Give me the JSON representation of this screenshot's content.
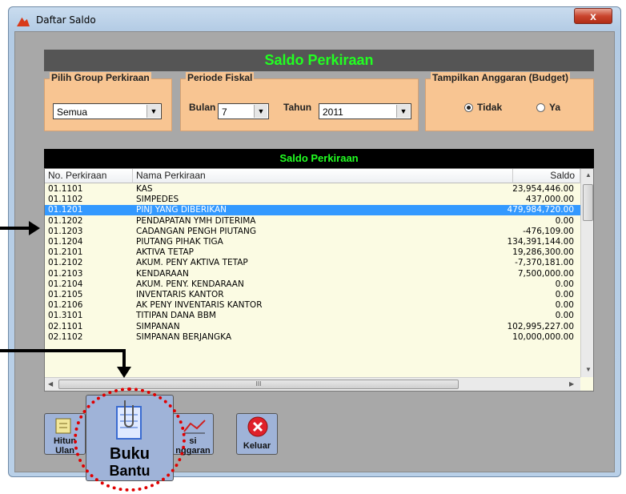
{
  "window": {
    "title": "Daftar Saldo",
    "close": "x"
  },
  "header": {
    "title": "Saldo Perkiraan"
  },
  "filters": {
    "group_label": "Pilih Group Perkiraan",
    "group_value": "Semua",
    "period_label": "Periode Fiskal",
    "bulan_label": "Bulan",
    "bulan_value": "7",
    "tahun_label": "Tahun",
    "tahun_value": "2011",
    "budget_label": "Tampilkan Anggaran (Budget)",
    "budget_no": "Tidak",
    "budget_yes": "Ya",
    "budget_selected": "Tidak"
  },
  "table": {
    "title": "Saldo Perkiraan",
    "columns": [
      "No. Perkiraan",
      "Nama Perkiraan",
      "Saldo"
    ],
    "rows": [
      [
        "01.1101",
        "KAS",
        "23,954,446.00"
      ],
      [
        "01.1102",
        "SIMPEDES",
        "437,000.00"
      ],
      [
        "01.1201",
        "PINJ YANG DIBERIKAN",
        "479,984,720.00"
      ],
      [
        "01.1202",
        "PENDAPATAN YMH DITERIMA",
        "0.00"
      ],
      [
        "01.1203",
        "CADANGAN PENGH PIUTANG",
        "-476,109.00"
      ],
      [
        "01.1204",
        "PIUTANG PIHAK TIGA",
        "134,391,144.00"
      ],
      [
        "01.2101",
        "AKTIVA TETAP",
        "19,286,300.00"
      ],
      [
        "01.2102",
        "AKUM. PENY AKTIVA TETAP",
        "-7,370,181.00"
      ],
      [
        "01.2103",
        "KENDARAAN",
        "7,500,000.00"
      ],
      [
        "01.2104",
        "AKUM. PENY. KENDARAAN",
        "0.00"
      ],
      [
        "01.2105",
        "INVENTARIS KANTOR",
        "0.00"
      ],
      [
        "01.2106",
        "AK PENY INVENTARIS KANTOR",
        "0.00"
      ],
      [
        "01.3101",
        "TITIPAN DANA BBM",
        "0.00"
      ],
      [
        "02.1101",
        "SIMPANAN",
        "102,995,227.00"
      ],
      [
        "02.1102",
        "SIMPANAN BERJANGKA",
        "10,000,000.00"
      ]
    ],
    "selected_row": 2,
    "hscroll_glyph": "III"
  },
  "buttons": {
    "hitung_line1": "Hitun",
    "hitung_line2": "Ulan",
    "anggaran_line1": "si",
    "anggaran_line2": "nggaran",
    "keluar": "Keluar",
    "buku_line1": "Buku",
    "buku_line2": "Bantu"
  },
  "colors": {
    "header_text": "#22ff22",
    "selection": "#3399ff",
    "group_bg": "#f8c592",
    "annotation": "#e00000"
  }
}
